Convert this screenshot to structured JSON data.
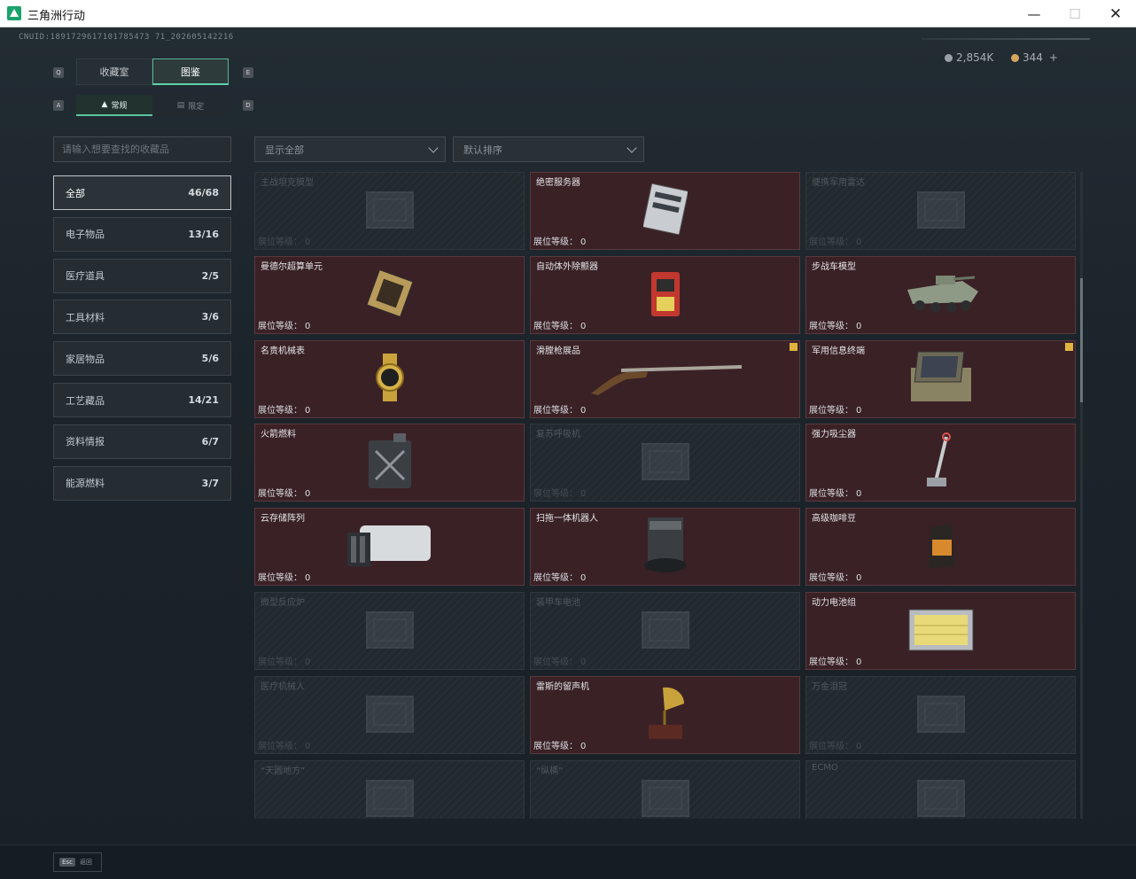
{
  "window": {
    "title": "三角洲行动"
  },
  "uid": "CNUID:1891729617101785473 71_202605142216",
  "currency": [
    {
      "value": "2,854K",
      "color": "#9aa1a6"
    },
    {
      "value": "344",
      "color": "#d7a65b",
      "plus": "+"
    }
  ],
  "tabs": [
    {
      "label": "收藏室",
      "active": false
    },
    {
      "label": "图鉴",
      "active": true
    }
  ],
  "tab_keys": [
    "Q",
    "E"
  ],
  "subtabs": [
    {
      "label": "常规",
      "icon": "flame-icon",
      "active": true
    },
    {
      "label": "限定",
      "icon": "ticket-icon",
      "active": false
    }
  ],
  "subtab_keys": [
    "A",
    "D"
  ],
  "search": {
    "placeholder": "请输入想要查找的收藏品"
  },
  "categories": [
    {
      "label": "全部",
      "count": "46/68",
      "active": true
    },
    {
      "label": "电子物品",
      "count": "13/16"
    },
    {
      "label": "医疗道具",
      "count": "2/5"
    },
    {
      "label": "工具材料",
      "count": "3/6"
    },
    {
      "label": "家居物品",
      "count": "5/6"
    },
    {
      "label": "工艺藏品",
      "count": "14/21"
    },
    {
      "label": "资料情报",
      "count": "6/7"
    },
    {
      "label": "能源燃料",
      "count": "3/7"
    }
  ],
  "filters": {
    "show": "显示全部",
    "sort": "默认排序"
  },
  "level_label": "展位等级：",
  "items": [
    {
      "name": "主战坦克模型",
      "level": "0",
      "owned": false,
      "icon": "tank-icon"
    },
    {
      "name": "绝密服务器",
      "level": "0",
      "owned": true,
      "icon": "server-icon"
    },
    {
      "name": "便携军用雷达",
      "level": "0",
      "owned": false,
      "icon": "radar-icon"
    },
    {
      "name": "曼德尔超算单元",
      "level": "0",
      "owned": true,
      "icon": "cpu-icon"
    },
    {
      "name": "自动体外除颤器",
      "level": "0",
      "owned": true,
      "icon": "defibrillator-icon"
    },
    {
      "name": "步战车模型",
      "level": "0",
      "owned": true,
      "icon": "ifv-icon"
    },
    {
      "name": "名贵机械表",
      "level": "0",
      "owned": true,
      "icon": "watch-icon"
    },
    {
      "name": "滑膛枪展品",
      "level": "0",
      "owned": true,
      "icon": "musket-icon",
      "badge": true
    },
    {
      "name": "军用信息终端",
      "level": "0",
      "owned": true,
      "icon": "terminal-icon",
      "badge": true
    },
    {
      "name": "火箭燃料",
      "level": "0",
      "owned": true,
      "icon": "fuel-can-icon"
    },
    {
      "name": "复苏呼吸机",
      "level": "0",
      "owned": false,
      "icon": "ventilator-icon"
    },
    {
      "name": "强力吸尘器",
      "level": "0",
      "owned": true,
      "icon": "vacuum-icon"
    },
    {
      "name": "云存储阵列",
      "level": "0",
      "owned": true,
      "icon": "storage-array-icon"
    },
    {
      "name": "扫拖一体机器人",
      "level": "0",
      "owned": true,
      "icon": "mop-robot-icon"
    },
    {
      "name": "高级咖啡豆",
      "level": "0",
      "owned": true,
      "icon": "coffee-bag-icon"
    },
    {
      "name": "微型反应炉",
      "level": "0",
      "owned": false,
      "icon": "reactor-icon"
    },
    {
      "name": "装甲车电池",
      "level": "0",
      "owned": false,
      "icon": "battery-icon"
    },
    {
      "name": "动力电池组",
      "level": "0",
      "owned": true,
      "icon": "battery-pack-icon"
    },
    {
      "name": "医疗机械人",
      "level": "0",
      "owned": false,
      "icon": "med-robot-icon"
    },
    {
      "name": "雷斯的留声机",
      "level": "0",
      "owned": true,
      "icon": "gramophone-icon"
    },
    {
      "name": "万金泪冠",
      "level": "0",
      "owned": false,
      "icon": "crown-icon"
    },
    {
      "name": "“天圆地方”",
      "level": "",
      "owned": false,
      "icon": "globe-icon"
    },
    {
      "name": "“纵横”",
      "level": "",
      "owned": false,
      "icon": "board-icon"
    },
    {
      "name": "ECMO",
      "level": "",
      "owned": false,
      "icon": "ecmo-icon"
    }
  ],
  "footer": {
    "key": "Esc",
    "label": "返回"
  }
}
